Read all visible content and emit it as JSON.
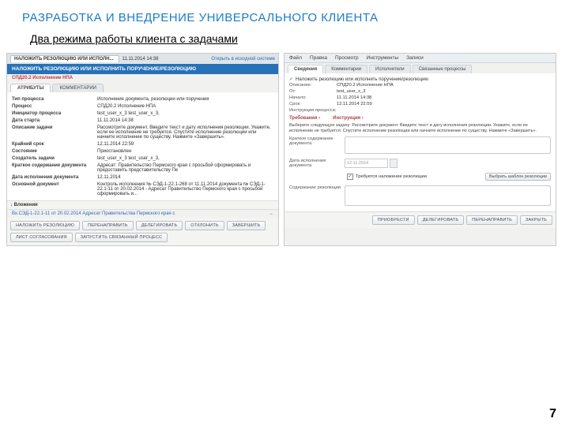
{
  "slide": {
    "title": "РАЗРАБОТКА И ВНЕДРЕНИЕ УНИВЕРСАЛЬНОГО КЛИЕНТА",
    "subtitle": "Два режима работы клиента с задачами",
    "page": "7"
  },
  "left": {
    "tab_title": "НАЛОЖИТЬ РЕЗОЛЮЦИЮ ИЛИ ИСПОЛН...",
    "timestamp": "11.11.2014 14:38",
    "open_link": "Открыть в исходной системе",
    "header": "НАЛОЖИТЬ РЕЗОЛЮЦИЮ ИЛИ ИСПОЛНИТЬ ПОРУЧЕНИЕ/РЕЗОЛЮЦИЮ",
    "process": "СПД20.2 Исполнение НПА",
    "tabs": [
      "АТРИБУТЫ",
      "КОММЕНТАРИИ"
    ],
    "rows": [
      {
        "k": "Тип процесса",
        "v": "Исполнение документа, резолюции или поручения"
      },
      {
        "k": "Процесс",
        "v": "СПД20.2 Исполнение НПА"
      },
      {
        "k": "Инициатор процесса",
        "v": "test_user_x_3 test_user_x_3,"
      },
      {
        "k": "Дата старта",
        "v": "11.11.2014 14:38"
      },
      {
        "k": "Описание задачи",
        "v": "Рассмотрите документ. Введите текст и дату исполнения резолюции. Укажите, если ее исполнение не требуется. Спустите исполнение резолюции или начните исполнение по существу. Нажмите «Завершить»."
      },
      {
        "k": "Крайний срок",
        "v": "12.11.2014 22:59"
      },
      {
        "k": "Состояние",
        "v": "Приостановлен"
      },
      {
        "k": "Создатель задачи",
        "v": "test_user_x_3 test_user_x_3,"
      },
      {
        "k": "Краткое содержание документа",
        "v": "Адресат: Правительство Пермского края  с просьбой сформировать и предоставить представительству Пе"
      },
      {
        "k": "Дата исполнения документа",
        "v": "12.11.2014"
      },
      {
        "k": "Основной документ",
        "v": "Контроль исполнения № СЭД-1-22.1-268 от 11.11.2014 документа № СЭД-1-22.1-11 от 20.02.2014 - Адресат Правительство Пермского края  с просьбой сформировать и..."
      }
    ],
    "attach_header": "↓ Вложения",
    "attach_item": "Вх.СЭД-1-22.1-11 от 20.02.2014 Адресат Правительства Пермского края  с",
    "attach_arrow": "→",
    "buttons": [
      "НАЛОЖИТЬ РЕЗОЛЮЦИЮ",
      "ПЕРЕНАПРАВИТЬ",
      "ДЕЛЕГИРОВАТЬ",
      "ОТКЛОНИТЬ",
      "ЗАВЕРШИТЬ",
      "ЛИСТ СОГЛАСОВАНИЯ",
      "ЗАПУСТИТЬ СВЯЗАННЫЙ ПРОЦЕСС"
    ]
  },
  "right": {
    "menu": [
      "Файл",
      "Правка",
      "Просмотр",
      "Инструменты",
      "Записи"
    ],
    "tabs": [
      "Сведения",
      "Комментарии",
      "Исполнители",
      "Связанные процессы"
    ],
    "task_line": "Наложить резолюцию или исполнить поручение/резолюцию",
    "kv": [
      {
        "k": "Описание:",
        "v": "СПД20.2 Исполнение НПА"
      },
      {
        "k": "От:",
        "v": "test_user_x_3"
      },
      {
        "k": "Начало:",
        "v": "11.11.2014 14:38"
      },
      {
        "k": "Срок:",
        "v": "12.11.2014 22:59"
      },
      {
        "k": "Инструкция процесса:",
        "v": ""
      }
    ],
    "sec_req": "Требования ›",
    "sec_instr": "Инструкция ›",
    "instr_text": "Выберите следующую задачу: Рассмотрите документ. Введите текст и дату исполнения резолюции. Укажите, если ее исполнение не требуется. Спустите исполнение резолюции или начните исполнение по существу. Нажмите «Завершить».",
    "f_summary": "Краткое содержание документа",
    "f_date": "Дата исполнения документа",
    "date_ph": "12.11.2014",
    "chk_label": "Требуется наложение резолюции",
    "sel_tmpl": "Выбрать шаблон резолюции",
    "f_res": "Содержание резолюции",
    "buttons": [
      "Приобрести",
      "Делегировать",
      "Перенаправить",
      "Закрыть"
    ]
  }
}
